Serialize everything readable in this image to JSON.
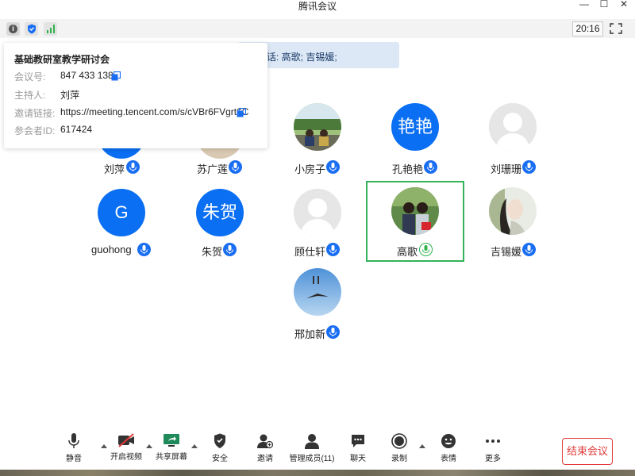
{
  "window": {
    "title": "腾讯会议"
  },
  "status": {
    "timer": "20:16"
  },
  "speaking": {
    "text": "话: 高歌; 吉锡媛;"
  },
  "meeting_info": {
    "title": "基础教研室教学研讨会",
    "rows": [
      {
        "label": "会议号:",
        "value": "847 433 138"
      },
      {
        "label": "主持人:",
        "value": "刘萍"
      },
      {
        "label": "邀请链接:",
        "value": "https://meeting.tencent.com/s/cVBr6FVgrt6C"
      },
      {
        "label": "参会者ID:",
        "value": "617424"
      }
    ]
  },
  "participants": [
    {
      "name": "刘萍",
      "avatar": "photo"
    },
    {
      "name": "苏广莲",
      "avatar": "photo"
    },
    {
      "name": "小房子",
      "avatar": "photo"
    },
    {
      "name": "孔艳艳",
      "avatar": "text",
      "avatar_text": "艳艳"
    },
    {
      "name": "刘珊珊",
      "avatar": "default"
    },
    {
      "name": "guohong",
      "avatar": "text",
      "avatar_text": "G"
    },
    {
      "name": "朱贺",
      "avatar": "text",
      "avatar_text": "朱贺"
    },
    {
      "name": "顾仕轩",
      "avatar": "default"
    },
    {
      "name": "高歌",
      "avatar": "photo",
      "speaking": true
    },
    {
      "name": "吉锡媛",
      "avatar": "photo"
    },
    {
      "name": "邢加新",
      "avatar": "photo"
    }
  ],
  "toolbar": {
    "mute": "静音",
    "video": "开启视频",
    "share": "共享屏幕",
    "security": "安全",
    "invite": "邀请",
    "members": "管理成员(11)",
    "chat": "聊天",
    "record": "录制",
    "reactions": "表情",
    "more": "更多",
    "end": "结束会议"
  },
  "colors": {
    "accent": "#0a6ff2",
    "speaking_border": "#33b35a",
    "end_red": "#e23a3a"
  }
}
